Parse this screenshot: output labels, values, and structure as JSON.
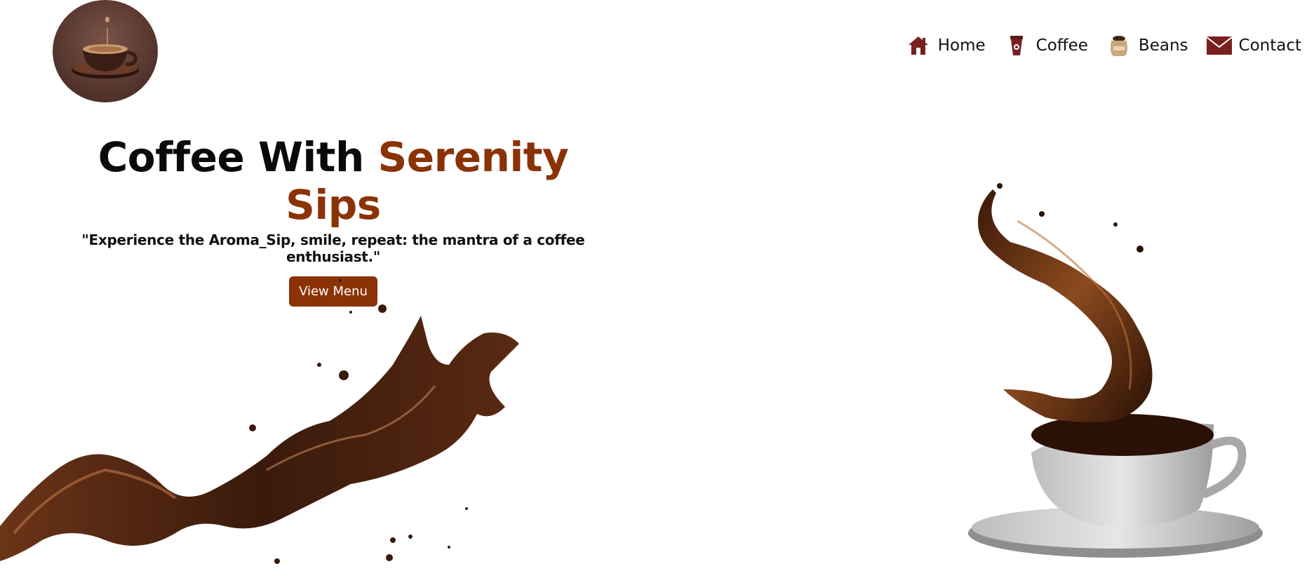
{
  "header": {
    "logo_name": "coffee-cup-logo"
  },
  "nav": {
    "items": [
      {
        "label": "Home",
        "icon": "house-icon"
      },
      {
        "label": "Coffee",
        "icon": "coffee-cup-icon"
      },
      {
        "label": "Beans",
        "icon": "bean-sack-icon"
      },
      {
        "label": "Contact",
        "icon": "envelope-icon"
      }
    ]
  },
  "hero": {
    "title_prefix": "Coffee With ",
    "title_accent": "Serenity Sips",
    "quote": "\"Experience the Aroma_Sip, smile, repeat: the mantra of a coffee enthusiast.\"",
    "button_label": "View Menu"
  },
  "colors": {
    "accent": "#8b3206",
    "nav_icon": "#7a1f1f",
    "coffee": "#4a2210"
  }
}
